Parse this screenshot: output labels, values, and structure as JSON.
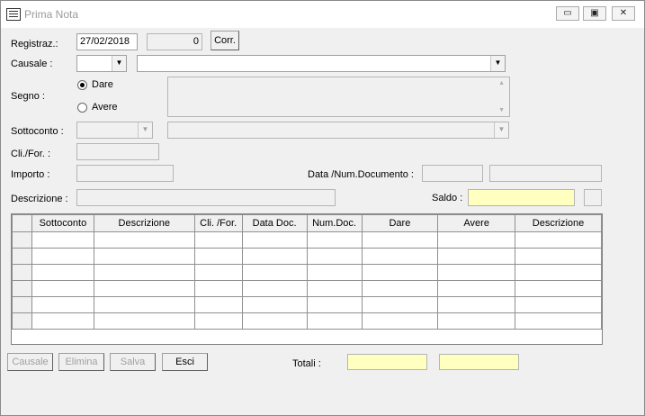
{
  "window": {
    "title": "Prima Nota",
    "minimize_glyph": "▭",
    "maximize_glyph": "▣",
    "close_glyph": "✕"
  },
  "form": {
    "registraz_label": "Registraz.:",
    "registraz_date": "27/02/2018",
    "registraz_number": "0",
    "corr_button": "Corr.",
    "causale_label": "Causale :",
    "causale_code": "",
    "causale_desc": "",
    "segno_label": "Segno :",
    "dare_label": "Dare",
    "avere_label": "Avere",
    "segno_selected": "Dare",
    "sottoconto_label": "Sottoconto :",
    "cli_for_label": "Cli./For. :",
    "importo_label": "Importo :",
    "data_num_doc_label": "Data /Num.Documento :",
    "descrizione_label": "Descrizione :",
    "saldo_label": "Saldo :"
  },
  "grid": {
    "columns": [
      "Sottoconto",
      "Descrizione",
      "Cli. /For.",
      "Data Doc.",
      "Num.Doc.",
      "Dare",
      "Avere",
      "Descrizione"
    ],
    "row_count": 6
  },
  "buttons": {
    "causale": "Causale",
    "elimina": "Elimina",
    "salva": "Salva",
    "esci": "Esci"
  },
  "totali_label": "Totali :",
  "colors": {
    "highlight_field": "#ffffc0",
    "disabled_field": "#f0f0f0",
    "window_bg": "#f0f0f0"
  },
  "icons": {
    "dropdown": "chevron-down-icon",
    "scroll_up": "scroll-up-arrow-icon",
    "scroll_down": "scroll-down-arrow-icon"
  }
}
